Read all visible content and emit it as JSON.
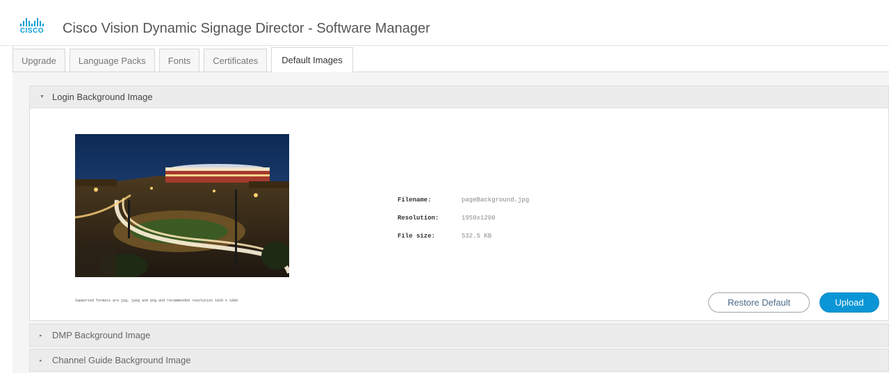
{
  "header": {
    "logo_text": "CISCO",
    "title": "Cisco Vision Dynamic Signage Director - Software Manager"
  },
  "tabs": [
    {
      "label": "Upgrade",
      "active": false
    },
    {
      "label": "Language Packs",
      "active": false
    },
    {
      "label": "Fonts",
      "active": false
    },
    {
      "label": "Certificates",
      "active": false
    },
    {
      "label": "Default Images",
      "active": true
    }
  ],
  "sections": {
    "login": {
      "title": "Login Background Image",
      "expanded": true
    },
    "dmp": {
      "title": "DMP Background Image",
      "expanded": false
    },
    "channel_guide": {
      "title": "Channel Guide Background Image",
      "expanded": false
    }
  },
  "image_info": {
    "filename_label": "Filename:",
    "filename_value": "pageBackground.jpg",
    "resolution_label": "Resolution:",
    "resolution_value": "1950x1200",
    "filesize_label": "File size:",
    "filesize_value": "532.5 KB"
  },
  "supported_formats_text": "Supported formats are jpg, jpeg and png and recommended resolution 1920 x 1080",
  "buttons": {
    "restore_default": "Restore Default",
    "upload": "Upload"
  },
  "colors": {
    "accent": "#049fd9",
    "primary_button": "#0a96d6"
  }
}
